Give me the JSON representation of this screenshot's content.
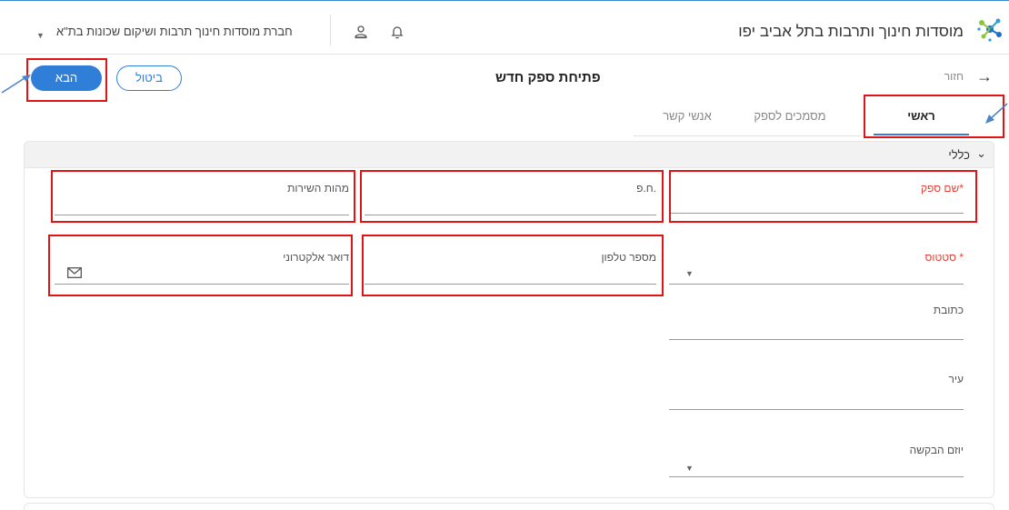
{
  "header": {
    "app_title": "מוסדות חינוך ותרבות בתל אביב יפו",
    "organization": "חברת מוסדות חינוך תרבות ושיקום שכונות בת\"א",
    "brand_color": "#2f7fd8",
    "icons": [
      "logo-icon",
      "user-icon",
      "bell-icon",
      "chevron-down-icon"
    ]
  },
  "page": {
    "back_label": "חזור",
    "title": "פתיחת ספק חדש",
    "cancel_label": "ביטול",
    "next_label": "הבא"
  },
  "tabs": [
    {
      "label": "ראשי",
      "active": true
    },
    {
      "label": "מסמכים לספק",
      "active": false
    },
    {
      "label": "אנשי קשר",
      "active": false
    }
  ],
  "section": {
    "title": "כללי"
  },
  "fields": {
    "supplier_name": {
      "label": "שם ספק",
      "required": "*",
      "value": ""
    },
    "company_id": {
      "label": "ח.פ.",
      "value": ""
    },
    "service_nature": {
      "label": "מהות השירות",
      "value": ""
    },
    "status": {
      "label": "סטטוס",
      "required": "*",
      "value": ""
    },
    "phone": {
      "label": "מספר טלפון",
      "value": ""
    },
    "email": {
      "label": "דואר אלקטרוני",
      "value": ""
    },
    "address": {
      "label": "כתובת",
      "value": ""
    },
    "city": {
      "label": "עיר",
      "value": ""
    },
    "requester": {
      "label": "יוזם הבקשה",
      "value": ""
    }
  },
  "colors": {
    "required": "#e0433a",
    "annotation_red": "#e01414",
    "annotation_arrow": "#4a86c6"
  }
}
